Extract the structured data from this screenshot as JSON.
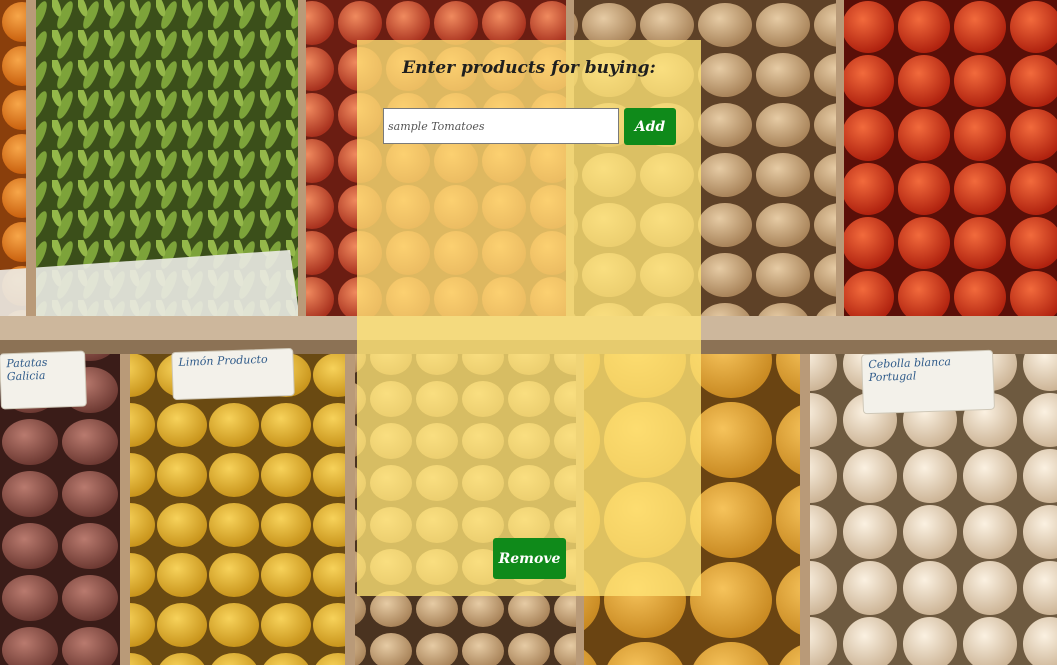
{
  "form": {
    "title": "Enter products for buying:",
    "input_placeholder": "sample Tomatoes",
    "input_value": "",
    "add_label": "Add",
    "remove_label": "Remove"
  },
  "products": [],
  "colors": {
    "panel": "#ffe476",
    "button": "#0f8a1a",
    "button_text": "#ffffff"
  },
  "background": {
    "description_icon": "vegetable-market-photo",
    "price_tags": [
      "Patatas Galicia",
      "Limón Producto",
      "Cebolla blanca Portugal"
    ]
  }
}
